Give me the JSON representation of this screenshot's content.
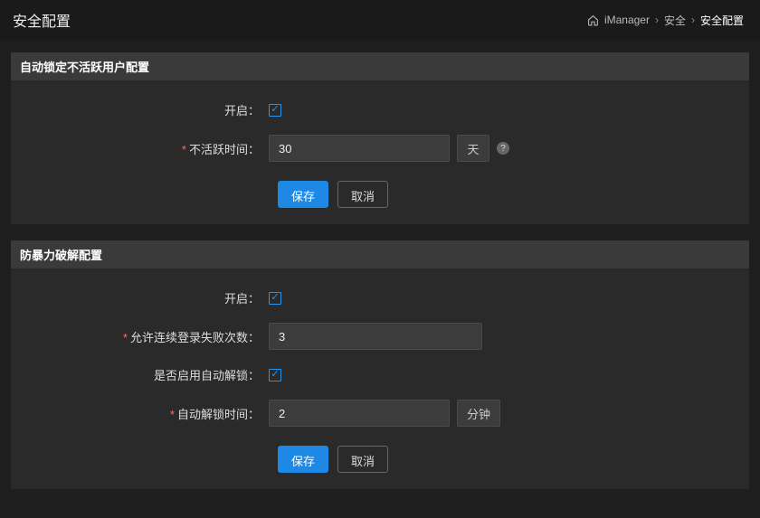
{
  "header": {
    "title": "安全配置",
    "breadcrumb": {
      "home": "iManager",
      "parent": "安全",
      "current": "安全配置"
    }
  },
  "section1": {
    "title": "自动锁定不活跃用户配置",
    "enable_label": "开启：",
    "enable_checked": true,
    "inactive_label": "不活跃时间：",
    "inactive_value": "30",
    "inactive_unit": "天",
    "save_label": "保存",
    "cancel_label": "取消"
  },
  "section2": {
    "title": "防暴力破解配置",
    "enable_label": "开启：",
    "enable_checked": true,
    "fail_count_label": "允许连续登录失败次数：",
    "fail_count_value": "3",
    "auto_unlock_label": "是否启用自动解锁：",
    "auto_unlock_checked": true,
    "unlock_time_label": "自动解锁时间：",
    "unlock_time_value": "2",
    "unlock_time_unit": "分钟",
    "save_label": "保存",
    "cancel_label": "取消"
  }
}
